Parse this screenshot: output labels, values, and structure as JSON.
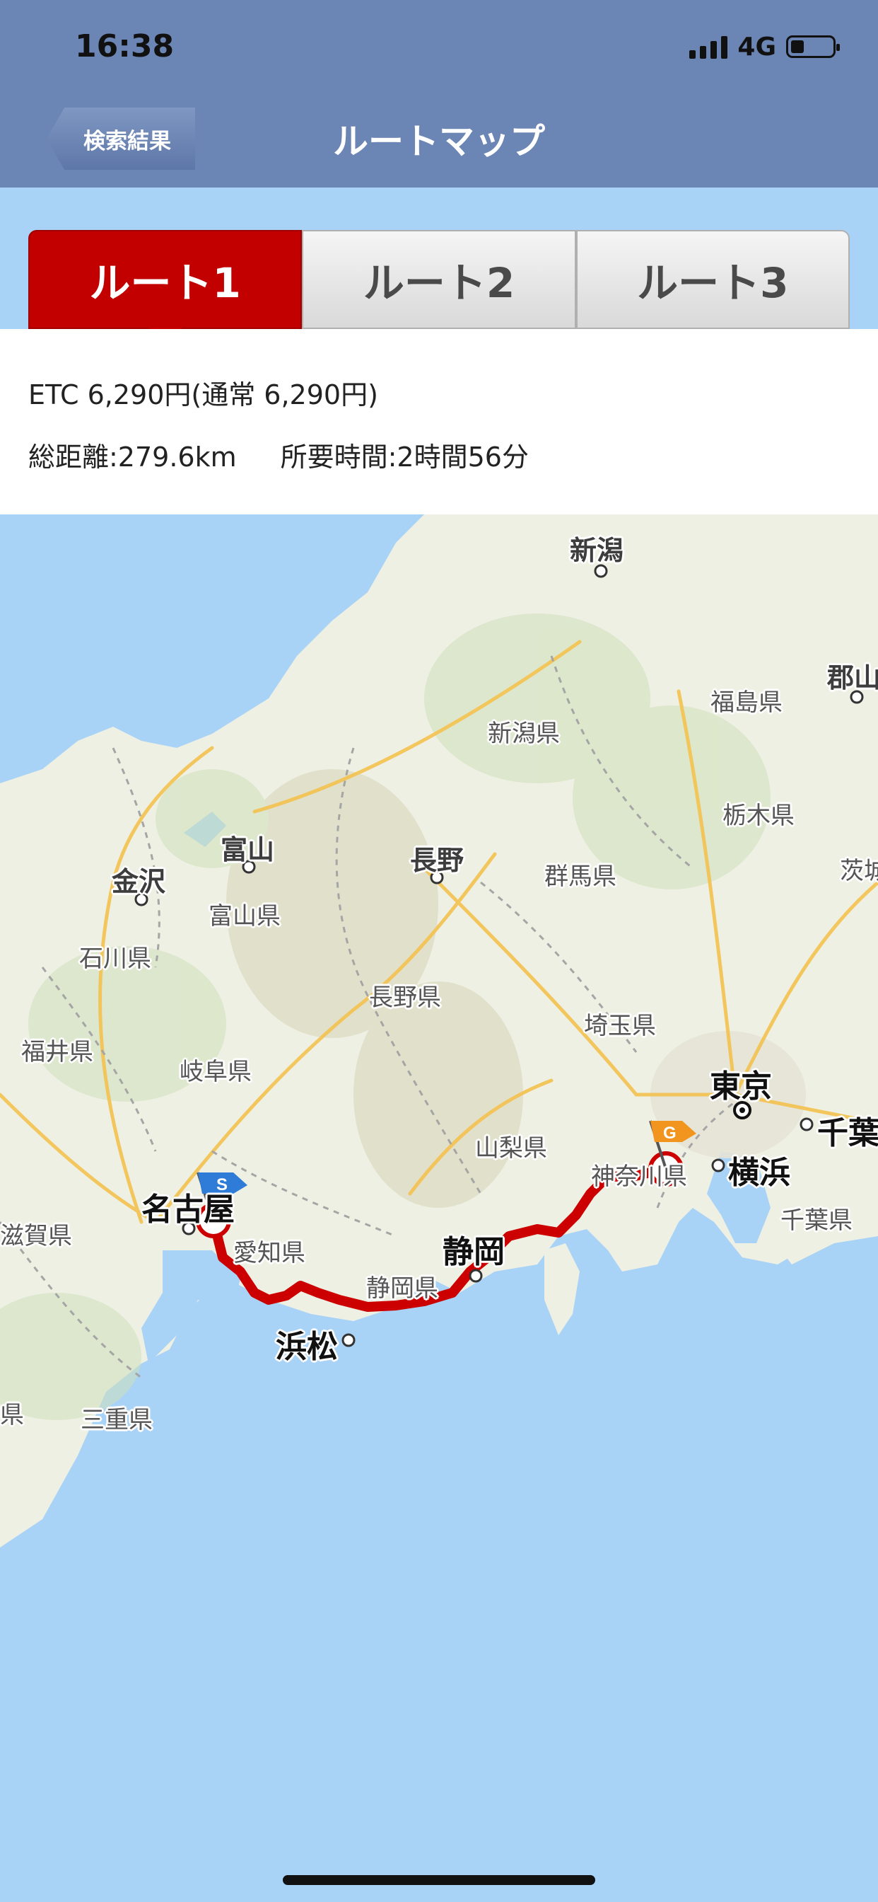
{
  "status_bar": {
    "time": "16:38",
    "network": "4G"
  },
  "nav": {
    "back_label": "検索結果",
    "title": "ルートマップ"
  },
  "tabs": [
    {
      "label": "ルート1",
      "active": true
    },
    {
      "label": "ルート2",
      "active": false
    },
    {
      "label": "ルート3",
      "active": false
    }
  ],
  "route_info": {
    "fare": "ETC 6,290円(通常 6,290円)",
    "distance": "総距離:279.6km",
    "duration": "所要時間:2時間56分"
  },
  "map": {
    "labels": {
      "niigata": "新潟",
      "koriyama": "郡山",
      "fukushima_ken": "福島県",
      "niigata_ken": "新潟県",
      "tochigi_ken": "栃木県",
      "toyama": "富山",
      "nagano": "長野",
      "gunma_ken": "群馬県",
      "ibaraki": "茨城",
      "kanazawa": "金沢",
      "toyama_ken": "富山県",
      "ishikawa_ken": "石川県",
      "nagano_ken": "長野県",
      "saitama_ken": "埼玉県",
      "fukui_ken": "福井県",
      "gifu_ken": "岐阜県",
      "tokyo": "東京",
      "yamanashi_ken": "山梨県",
      "chiba": "千葉",
      "kanagawa_ken": "神奈川県",
      "yokohama": "横浜",
      "nagoya": "名古屋",
      "shiga_ken": "滋賀県",
      "aichi_ken": "愛知県",
      "shizuoka": "静岡",
      "chiba_ken": "千葉県",
      "shizuoka_ken": "静岡県",
      "hamamatsu": "浜松",
      "ken_left": "県",
      "mie_ken": "三重県"
    },
    "start_marker": "S",
    "goal_marker": "G",
    "route_color": "#cc0000"
  }
}
